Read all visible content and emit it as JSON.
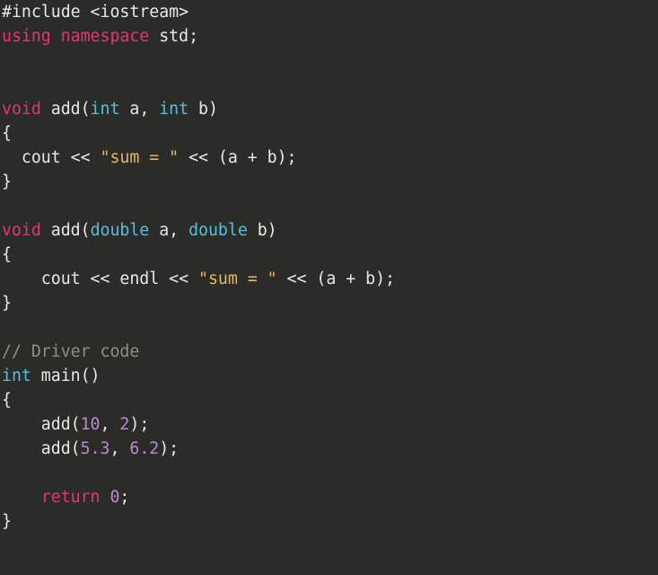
{
  "code": {
    "lang": "cpp",
    "tokens": [
      [
        {
          "t": "#include <iostream>",
          "c": "tok-pp"
        }
      ],
      [
        {
          "t": "using",
          "c": "tok-kw"
        },
        {
          "t": " ",
          "c": "tok-ident"
        },
        {
          "t": "namespace",
          "c": "tok-kw"
        },
        {
          "t": " std;",
          "c": "tok-ident"
        }
      ],
      [],
      [],
      [
        {
          "t": "void",
          "c": "tok-kw"
        },
        {
          "t": " add(",
          "c": "tok-ident"
        },
        {
          "t": "int",
          "c": "tok-type"
        },
        {
          "t": " a, ",
          "c": "tok-ident"
        },
        {
          "t": "int",
          "c": "tok-type"
        },
        {
          "t": " b)",
          "c": "tok-ident"
        }
      ],
      [
        {
          "t": "{",
          "c": "tok-punct"
        }
      ],
      [
        {
          "t": "  cout << ",
          "c": "tok-ident"
        },
        {
          "t": "\"sum = \"",
          "c": "tok-str"
        },
        {
          "t": " << (a + b);",
          "c": "tok-ident"
        }
      ],
      [
        {
          "t": "}",
          "c": "tok-punct"
        }
      ],
      [],
      [
        {
          "t": "void",
          "c": "tok-kw"
        },
        {
          "t": " add(",
          "c": "tok-ident"
        },
        {
          "t": "double",
          "c": "tok-type"
        },
        {
          "t": " a, ",
          "c": "tok-ident"
        },
        {
          "t": "double",
          "c": "tok-type"
        },
        {
          "t": " b)",
          "c": "tok-ident"
        }
      ],
      [
        {
          "t": "{",
          "c": "tok-punct"
        }
      ],
      [
        {
          "t": "    cout << endl << ",
          "c": "tok-ident"
        },
        {
          "t": "\"sum = \"",
          "c": "tok-str"
        },
        {
          "t": " << (a + b);",
          "c": "tok-ident"
        }
      ],
      [
        {
          "t": "}",
          "c": "tok-punct"
        }
      ],
      [],
      [
        {
          "t": "// Driver code",
          "c": "tok-comment"
        }
      ],
      [
        {
          "t": "int",
          "c": "tok-type"
        },
        {
          "t": " main()",
          "c": "tok-ident"
        }
      ],
      [
        {
          "t": "{",
          "c": "tok-punct"
        }
      ],
      [
        {
          "t": "    add(",
          "c": "tok-ident"
        },
        {
          "t": "10",
          "c": "tok-num"
        },
        {
          "t": ", ",
          "c": "tok-ident"
        },
        {
          "t": "2",
          "c": "tok-num"
        },
        {
          "t": ");",
          "c": "tok-ident"
        }
      ],
      [
        {
          "t": "    add(",
          "c": "tok-ident"
        },
        {
          "t": "5.3",
          "c": "tok-num"
        },
        {
          "t": ", ",
          "c": "tok-ident"
        },
        {
          "t": "6.2",
          "c": "tok-num"
        },
        {
          "t": ");",
          "c": "tok-ident"
        }
      ],
      [],
      [
        {
          "t": "    ",
          "c": "tok-ident"
        },
        {
          "t": "return",
          "c": "tok-kw"
        },
        {
          "t": " ",
          "c": "tok-ident"
        },
        {
          "t": "0",
          "c": "tok-num"
        },
        {
          "t": ";",
          "c": "tok-ident"
        }
      ],
      [
        {
          "t": "}",
          "c": "tok-punct"
        }
      ]
    ]
  }
}
